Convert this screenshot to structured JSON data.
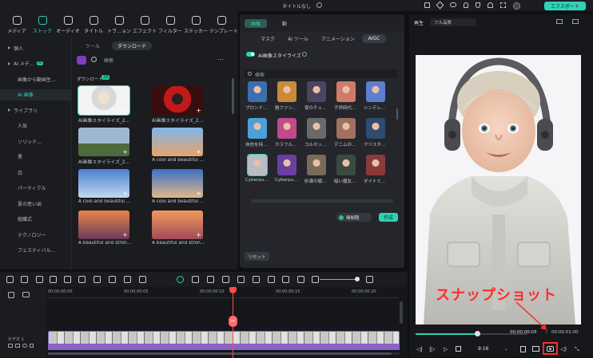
{
  "window": {
    "title": "タイトルなし",
    "export_label": "エクスポート"
  },
  "toolbar": {
    "items": [
      {
        "label": "メディア",
        "icon": "media-icon"
      },
      {
        "label": "ストック",
        "icon": "stock-icon",
        "active": true
      },
      {
        "label": "オーディオ",
        "icon": "music-note-icon"
      },
      {
        "label": "タイトル",
        "icon": "text-t-icon"
      },
      {
        "label": "トラ…ョン",
        "icon": "transition-icon"
      },
      {
        "label": "エフェクト",
        "icon": "effect-star-icon"
      },
      {
        "label": "フィルター",
        "icon": "filter-icon"
      },
      {
        "label": "ステッカー",
        "icon": "sticker-icon"
      },
      {
        "label": "テンプレート",
        "icon": "template-icon"
      }
    ]
  },
  "sidebar": {
    "items": [
      {
        "label": "個人",
        "type": "group"
      },
      {
        "label": "AI メデ…",
        "type": "group",
        "badge": "AI"
      },
      {
        "label": "画像から動画生…",
        "type": "child"
      },
      {
        "label": "AI 画像",
        "type": "child",
        "active": true
      },
      {
        "label": "ライブラリ",
        "type": "group"
      },
      {
        "label": "人気",
        "type": "child"
      },
      {
        "label": "ソリッド…",
        "type": "child"
      },
      {
        "label": "黒",
        "type": "child"
      },
      {
        "label": "白",
        "type": "child"
      },
      {
        "label": "パーティクル",
        "type": "child"
      },
      {
        "label": "夏の思い出",
        "type": "child"
      },
      {
        "label": "組織式",
        "type": "child"
      },
      {
        "label": "テクノロジー",
        "type": "child"
      },
      {
        "label": "フェスティバル…",
        "type": "child"
      }
    ]
  },
  "media": {
    "tabs": [
      "ツール",
      "ダウンロード"
    ],
    "active_tab": "ダウンロード",
    "search_placeholder": "検索",
    "section_label": "ダウンロード",
    "section_count": "33",
    "items": [
      {
        "label": "AI画像スタイライズ_2…",
        "scene": "child"
      },
      {
        "label": "AI画像スタイライズ_2…",
        "scene": "red"
      },
      {
        "label": "AI画像スタイライズ_2…",
        "scene": "castle"
      },
      {
        "label": "A cool and beautiful …",
        "scene": "anime-sky"
      },
      {
        "label": "A cool and beautiful …",
        "scene": "anime-blue"
      },
      {
        "label": "A cool and beautiful …",
        "scene": "anime-blue2"
      },
      {
        "label": "A beautiful and stron…",
        "scene": "anime-sunset"
      },
      {
        "label": "A beautiful and stron…",
        "scene": "anime-sunset2"
      }
    ]
  },
  "ai_panel": {
    "top_tabs": [
      "画像",
      "動"
    ],
    "sub_tabs": [
      "マスク",
      "AI ツール",
      "アニメーション",
      "AIGC"
    ],
    "active_sub_tab": "AIGC",
    "toggle_label": "AI画像スタイライズ",
    "search_placeholder": "検索",
    "styles": [
      {
        "label": "ブロンド…",
        "c": "#3a6fb0"
      },
      {
        "label": "鎧ファン…",
        "c": "#c98a3a"
      },
      {
        "label": "夜のチェ…",
        "c": "#4a4560"
      },
      {
        "label": "子供時代…",
        "c": "#d07a6a"
      },
      {
        "label": "シンデレ…",
        "c": "#5d7fd0"
      },
      {
        "label": "自信を持…",
        "c": "#4aa0d8"
      },
      {
        "label": "カラフル…",
        "c": "#c04a8a"
      },
      {
        "label": "コルセッ…",
        "c": "#6a6a6a"
      },
      {
        "label": "デニムの…",
        "c": "#a07060"
      },
      {
        "label": "クリスタ…",
        "c": "#2f4b6e"
      },
      {
        "label": "Cyberpu…",
        "c": "#b8bcc4"
      },
      {
        "label": "Cyberpu…",
        "c": "#6a3fa0"
      },
      {
        "label": "砂漠の戦…",
        "c": "#7a6a58"
      },
      {
        "label": "暗い魔女…",
        "c": "#3a4a40"
      },
      {
        "label": "ダイナミ…",
        "c": "#8a3a3a"
      }
    ],
    "free_label": "無制限",
    "create_label": "作成",
    "reset_label": "リセット"
  },
  "player": {
    "label": "再生",
    "quality": "フル品質",
    "current_time": "00:00:00:03",
    "total_time": "00:00:01:00",
    "aspect": "9:16",
    "progress_pct": 55
  },
  "timeline": {
    "ruler": [
      "00:00:00:00",
      "00:00:00:05",
      "00:00:00:10",
      "00:00:00:15",
      "00:00:00:20"
    ],
    "track_label": "ビデオ 1"
  },
  "annotation": {
    "text": "スナップショット",
    "color": "#ff2c2c"
  }
}
